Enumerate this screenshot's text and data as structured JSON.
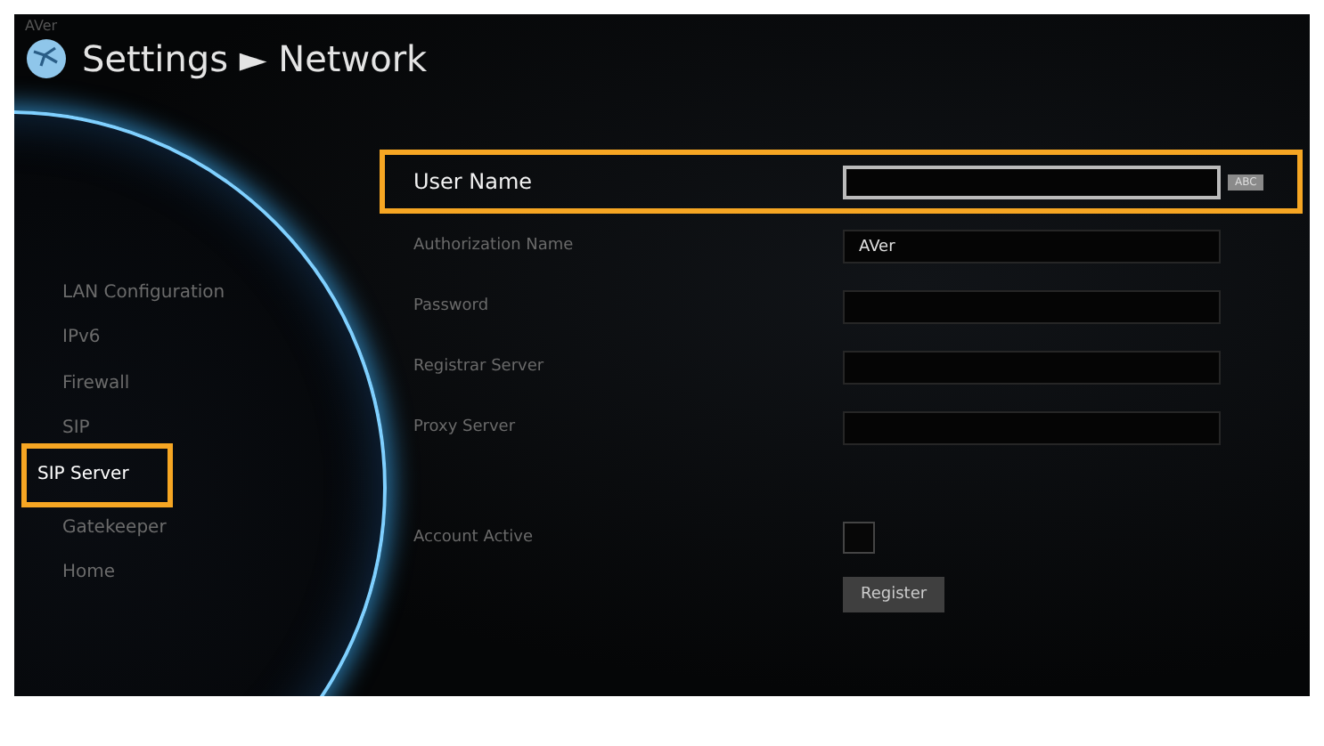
{
  "brand": "AVer",
  "title": {
    "section": "Settings",
    "separator": "►",
    "page": "Network"
  },
  "sidebar": {
    "items": [
      {
        "label": "LAN Configuration",
        "selected": false
      },
      {
        "label": "IPv6",
        "selected": false
      },
      {
        "label": "Firewall",
        "selected": false
      },
      {
        "label": "SIP",
        "selected": false
      },
      {
        "label": "SIP Server",
        "selected": true
      },
      {
        "label": "Gatekeeper",
        "selected": false
      },
      {
        "label": "Home",
        "selected": false
      }
    ]
  },
  "form": {
    "rows": [
      {
        "kind": "text",
        "label": "User Name",
        "value": "",
        "selected": true,
        "input_badge": "ABC"
      },
      {
        "kind": "text",
        "label": "Authorization Name",
        "value": "AVer",
        "selected": false
      },
      {
        "kind": "text",
        "label": "Password",
        "value": "",
        "selected": false
      },
      {
        "kind": "text",
        "label": "Registrar Server",
        "value": "",
        "selected": false
      },
      {
        "kind": "text",
        "label": "Proxy Server",
        "value": "",
        "selected": false
      },
      {
        "kind": "checkbox",
        "label": "Account Active",
        "checked": false,
        "selected": false
      }
    ],
    "button": "Register"
  }
}
